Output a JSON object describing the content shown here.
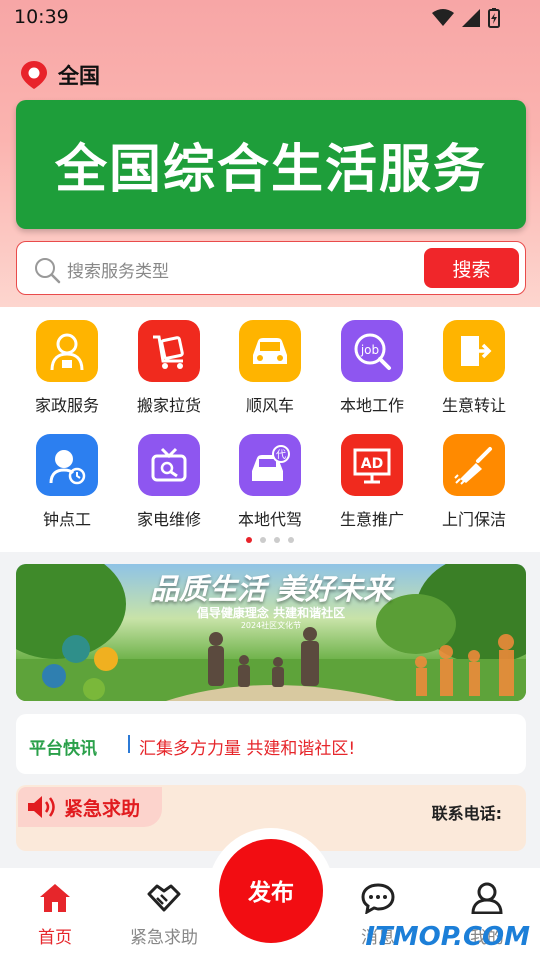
{
  "status_bar": {
    "time": "10:39"
  },
  "location": {
    "city": "全国"
  },
  "banner": {
    "text": "全国综合生活服务",
    "bg_color": "#1e9e3a"
  },
  "search": {
    "placeholder": "搜索服务类型",
    "button_label": "搜索"
  },
  "services": [
    {
      "label": "家政服务",
      "icon": "housekeeper-icon",
      "color": "#ffb400"
    },
    {
      "label": "搬家拉货",
      "icon": "moving-cart-icon",
      "color": "#f02a1e"
    },
    {
      "label": "顺风车",
      "icon": "car-icon",
      "color": "#ffb400"
    },
    {
      "label": "本地工作",
      "icon": "job-search-icon",
      "color": "#8e56f0"
    },
    {
      "label": "生意转让",
      "icon": "exit-door-icon",
      "color": "#ffb400"
    },
    {
      "label": "钟点工",
      "icon": "hourly-worker-icon",
      "color": "#2c7ff0"
    },
    {
      "label": "家电维修",
      "icon": "tv-repair-icon",
      "color": "#8e56f0"
    },
    {
      "label": "本地代驾",
      "icon": "designated-driver-icon",
      "color": "#8e56f0"
    },
    {
      "label": "生意推广",
      "icon": "ad-board-icon",
      "color": "#f02a1e"
    },
    {
      "label": "上门保洁",
      "icon": "cleaning-brush-icon",
      "color": "#ff8a00"
    }
  ],
  "pager": {
    "count": 4,
    "active": 0
  },
  "promo": {
    "title": "品质生活 美好未来",
    "subtitle": "倡导健康理念 共建和谐社区",
    "caption": "2024社区文化节"
  },
  "news": {
    "tag": "平台快讯",
    "text": "汇集多方力量 共建和谐社区!"
  },
  "emergency": {
    "label": "紧急求助",
    "phone_label": "联系电话:"
  },
  "tabbar": {
    "home": "首页",
    "help": "紧急求助",
    "publish": "发布",
    "messages": "消息",
    "mine": "我的"
  },
  "watermark": "ITMOP.COM",
  "colors": {
    "accent": "#e6262b",
    "green": "#2aa04a"
  }
}
